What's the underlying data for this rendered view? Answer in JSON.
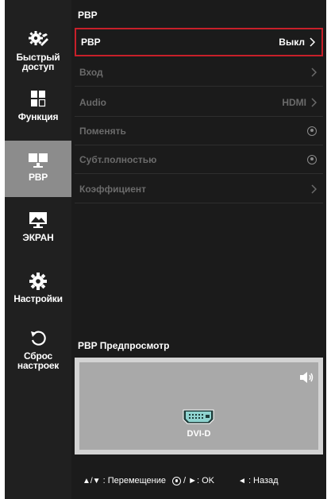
{
  "sidebar": {
    "items": [
      {
        "id": "quick",
        "label_line1": "Быстрый",
        "label_line2": "доступ",
        "icon": "gear-wrench-icon",
        "active": false
      },
      {
        "id": "function",
        "label_line1": "Функция",
        "label_line2": "",
        "icon": "grid-icon",
        "active": false
      },
      {
        "id": "pbp",
        "label_line1": "PBP",
        "label_line2": "",
        "icon": "dual-monitor-icon",
        "active": true
      },
      {
        "id": "screen",
        "label_line1": "ЭКРАН",
        "label_line2": "",
        "icon": "monitor-icon",
        "active": false
      },
      {
        "id": "settings",
        "label_line1": "Настройки",
        "label_line2": "",
        "icon": "gear-icon",
        "active": false
      },
      {
        "id": "reset",
        "label_line1": "Сброс",
        "label_line2": "настроек",
        "icon": "reset-icon",
        "active": false
      }
    ]
  },
  "section_title": "PBP",
  "menu": [
    {
      "label": "PBP",
      "value": "Выкл",
      "control": "chevron",
      "enabled": true,
      "selected": true
    },
    {
      "label": "Вход",
      "value": "",
      "control": "chevron",
      "enabled": false,
      "selected": false
    },
    {
      "label": "Audio",
      "value": "HDMI",
      "control": "chevron",
      "enabled": false,
      "selected": false
    },
    {
      "label": "Поменять",
      "value": "",
      "control": "radio",
      "enabled": false,
      "selected": false
    },
    {
      "label": "Субт.полностью",
      "value": "",
      "control": "radio",
      "enabled": false,
      "selected": false
    },
    {
      "label": "Коэффициент",
      "value": "",
      "control": "chevron",
      "enabled": false,
      "selected": false
    }
  ],
  "preview": {
    "title": "PBP Предпросмотр",
    "input_label": "DVI-D",
    "speaker_icon": "speaker-icon"
  },
  "footer": {
    "move_symbol": "▲/▼",
    "move_label": ": Перемещение",
    "ok_label": "/ ►: OK",
    "back_symbol": "◄",
    "back_label": ": Назад"
  },
  "colors": {
    "background": "#1b1b1b",
    "sidebar": "#202020",
    "active_nav": "#8c8c8c",
    "selection_border": "#c8202a",
    "disabled_text": "#6b6b6b",
    "preview_frame": "#d3d3d3",
    "preview_fill": "#a9a9a9",
    "connector_teal": "#8fd3cf"
  }
}
